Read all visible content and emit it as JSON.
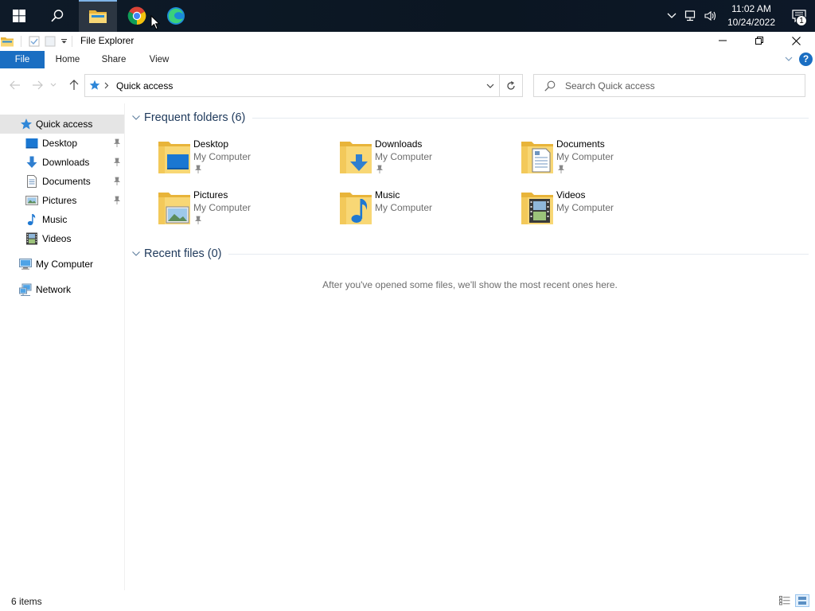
{
  "taskbar": {
    "start_icon": "windows-logo-icon",
    "search_icon": "search-icon",
    "apps": [
      {
        "name": "File Explorer",
        "icon": "folder-icon",
        "active": true
      },
      {
        "name": "Google Chrome",
        "icon": "chrome-icon",
        "active": false
      },
      {
        "name": "Microsoft Edge",
        "icon": "edge-icon",
        "active": false
      }
    ],
    "tray": {
      "time": "11:02 AM",
      "date": "10/24/2022",
      "notification_count": "1"
    }
  },
  "window": {
    "title": "File Explorer",
    "ribbon_tabs": [
      "File",
      "Home",
      "Share",
      "View"
    ],
    "help_label": "?"
  },
  "address": {
    "path": "Quick access",
    "search_placeholder": "Search Quick access"
  },
  "nav_pane": {
    "quick_access": "Quick access",
    "items": [
      {
        "label": "Desktop",
        "icon": "desktop-icon",
        "pinned": true
      },
      {
        "label": "Downloads",
        "icon": "downloads-icon",
        "pinned": true
      },
      {
        "label": "Documents",
        "icon": "documents-icon",
        "pinned": true
      },
      {
        "label": "Pictures",
        "icon": "pictures-icon",
        "pinned": true
      },
      {
        "label": "Music",
        "icon": "music-icon",
        "pinned": false
      },
      {
        "label": "Videos",
        "icon": "videos-icon",
        "pinned": false
      }
    ],
    "my_computer": "My Computer",
    "network": "Network"
  },
  "content": {
    "frequent_title": "Frequent folders (6)",
    "folders": [
      {
        "name": "Desktop",
        "location": "My Computer",
        "pinned": true,
        "overlay": "desktop"
      },
      {
        "name": "Downloads",
        "location": "My Computer",
        "pinned": true,
        "overlay": "downloads"
      },
      {
        "name": "Documents",
        "location": "My Computer",
        "pinned": true,
        "overlay": "documents"
      },
      {
        "name": "Pictures",
        "location": "My Computer",
        "pinned": true,
        "overlay": "pictures"
      },
      {
        "name": "Music",
        "location": "My Computer",
        "pinned": false,
        "overlay": "music"
      },
      {
        "name": "Videos",
        "location": "My Computer",
        "pinned": false,
        "overlay": "videos"
      }
    ],
    "recent_title": "Recent files (0)",
    "recent_empty": "After you've opened some files, we'll show the most recent ones here."
  },
  "status": {
    "item_count": "6 items"
  },
  "colors": {
    "accent": "#1a6ec2",
    "folder_yellow": "#f8d775",
    "selection": "#cce8ff",
    "group_title": "#1e395b"
  }
}
